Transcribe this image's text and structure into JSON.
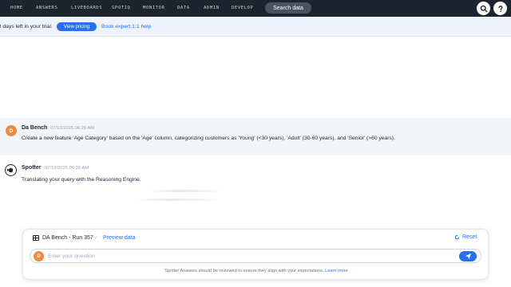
{
  "nav": {
    "items": [
      "HOME",
      "ANSWERS",
      "LIVEBOARDS",
      "SPOTIQ",
      "MONITOR",
      "DATA",
      "ADMIN",
      "DEVELOP"
    ],
    "search_label": "Search data",
    "search_icon": "search-icon",
    "help_icon": "help-icon"
  },
  "trial": {
    "message": "l days left in your trial.",
    "pricing_label": "View pricing",
    "expert_label": "Book expert 1:1 help"
  },
  "conversation": {
    "user_message": {
      "avatar_letter": "D",
      "sender": "Da Bench",
      "timestamp": "07/10/2025 06:26 AM",
      "text": "Create a new feature 'Age Category' based on the 'Age' column, categorizing customers as 'Young' (<30 years), 'Adult' (30-60 years), and 'Senior' (>60 years)."
    },
    "spotter_message": {
      "sender": "Spotter",
      "timestamp": "07/10/2025 06:26 AM",
      "text": "Translating your query with the Reasoning Engine."
    }
  },
  "composer": {
    "datasource": "DA Bench - Run 357",
    "preview_label": "Preview data",
    "reset_label": "Reset",
    "avatar_letter": "D",
    "placeholder": "Enter your question",
    "value": "",
    "disclaimer": "Spotter Answers should be reviewed to ensure they align with your expectations.",
    "learn_more": "Learn more"
  },
  "colors": {
    "nav_bg": "#1d232f",
    "accent": "#2770ef",
    "avatar": "#ef8a43",
    "trial_bg": "#eef3fb",
    "user_msg_bg": "#f3f6f9"
  }
}
